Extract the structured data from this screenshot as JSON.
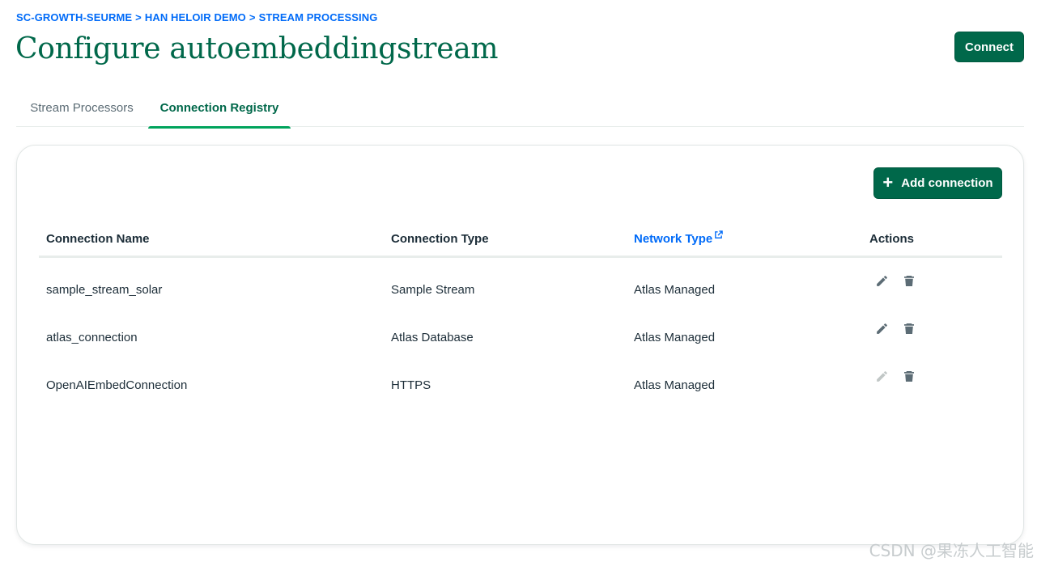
{
  "breadcrumb": {
    "org": "SC-GROWTH-SEURME",
    "project": "HAN HELOIR DEMO",
    "section": "STREAM PROCESSING",
    "separator": ">"
  },
  "page_title": "Configure autoembeddingstream",
  "connect_button": "Connect",
  "tabs": [
    {
      "label": "Stream Processors",
      "active": false
    },
    {
      "label": "Connection Registry",
      "active": true
    }
  ],
  "add_connection_button": "Add connection",
  "table": {
    "columns": [
      "Connection Name",
      "Connection Type",
      "Network Type",
      "Actions"
    ],
    "rows": [
      {
        "name": "sample_stream_solar",
        "type": "Sample Stream",
        "network": "Atlas Managed",
        "edit_enabled": true
      },
      {
        "name": "atlas_connection",
        "type": "Atlas Database",
        "network": "Atlas Managed",
        "edit_enabled": true
      },
      {
        "name": "OpenAIEmbedConnection",
        "type": "HTTPS",
        "network": "Atlas Managed",
        "edit_enabled": false
      }
    ]
  },
  "icons": {
    "edit": "pencil-icon",
    "delete": "trash-icon",
    "external_link": "external-link-icon",
    "add": "plus-icon"
  },
  "colors": {
    "brand_green": "#00684a",
    "link_blue": "#016bf8",
    "tab_underline": "#00a35c"
  },
  "watermark": "CSDN @果冻人工智能"
}
